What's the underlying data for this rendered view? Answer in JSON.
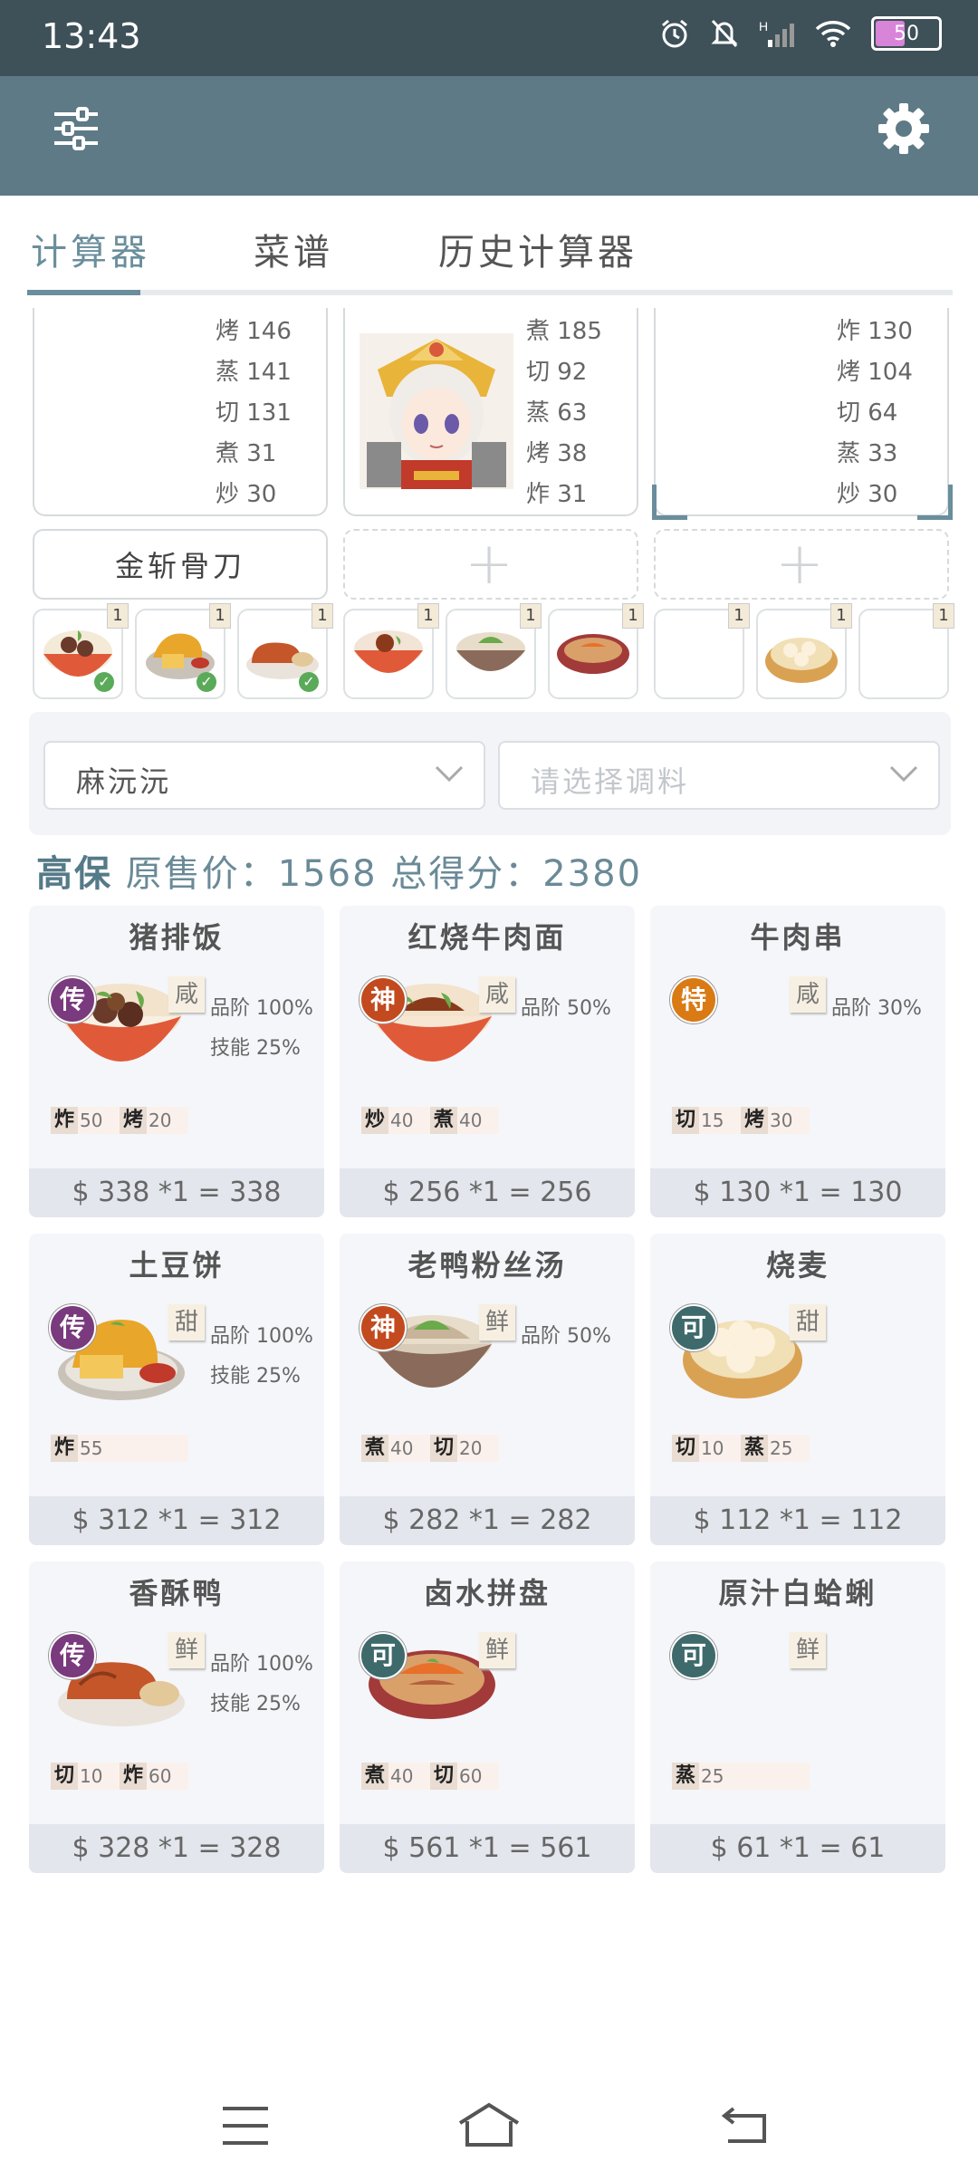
{
  "status": {
    "time": "13:43",
    "battery": "50"
  },
  "tabs": [
    {
      "label": "计算器"
    },
    {
      "label": "菜谱"
    },
    {
      "label": "历史计算器"
    }
  ],
  "chefs": [
    {
      "skills": [
        "烤 146",
        "蒸 141",
        "切 131",
        "煮 31",
        "炒 30"
      ],
      "equip": "金斩骨刀"
    },
    {
      "skills": [
        "煮 185",
        "切 92",
        "蒸 63",
        "烤 38",
        "炸 31"
      ],
      "equip": "+"
    },
    {
      "skills": [
        "炸 130",
        "烤 104",
        "切 64",
        "蒸 33",
        "炒 30"
      ],
      "equip": "+"
    }
  ],
  "slots": [
    {
      "qty": "1",
      "icon": "pork-rice"
    },
    {
      "qty": "1",
      "icon": "potato-cake"
    },
    {
      "qty": "1",
      "icon": "crispy-duck"
    },
    {
      "qty": "1",
      "icon": "beef-noodle"
    },
    {
      "qty": "1",
      "icon": "duck-soup"
    },
    {
      "qty": "1",
      "icon": "braised-platter"
    },
    {
      "qty": "1",
      "icon": "empty"
    },
    {
      "qty": "1",
      "icon": "shaomai"
    },
    {
      "qty": "1",
      "icon": "empty"
    }
  ],
  "condiment": {
    "chef_select": "麻沅沅",
    "seasoning_placeholder": "请选择调料"
  },
  "summary": {
    "chef": "高保",
    "text": "原售价：1568 总得分：2380"
  },
  "colors": {
    "accent": "#6a8e9c",
    "appbar": "#5e7a86",
    "rarity_chuan": "#7a3a7e",
    "rarity_shen": "#c24a1e",
    "rarity_te": "#d97a15",
    "rarity_ke": "#3f6a6c"
  },
  "dishes": [
    {
      "name": "猪排饭",
      "rarity": "传",
      "rcolor": "#7a3a7e",
      "flavor": "咸",
      "q1": "品阶 100%",
      "q2": "技能 25%",
      "reqs": [
        [
          "炸",
          "50"
        ],
        [
          "烤",
          "20"
        ]
      ],
      "price": "$ 338 *1 = 338",
      "icon": "pork-rice"
    },
    {
      "name": "红烧牛肉面",
      "rarity": "神",
      "rcolor": "#c24a1e",
      "flavor": "咸",
      "q1": "品阶 50%",
      "q2": "",
      "reqs": [
        [
          "炒",
          "40"
        ],
        [
          "煮",
          "40"
        ]
      ],
      "price": "$ 256 *1 = 256",
      "icon": "beef-noodle"
    },
    {
      "name": "牛肉串",
      "rarity": "特",
      "rcolor": "#d97a15",
      "flavor": "咸",
      "q1": "品阶 30%",
      "q2": "",
      "reqs": [
        [
          "切",
          "15"
        ],
        [
          "烤",
          "30"
        ]
      ],
      "price": "$ 130 *1 = 130",
      "icon": "none"
    },
    {
      "name": "土豆饼",
      "rarity": "传",
      "rcolor": "#7a3a7e",
      "flavor": "甜",
      "q1": "品阶 100%",
      "q2": "技能 25%",
      "reqs": [
        [
          "炸",
          "55"
        ]
      ],
      "price": "$ 312 *1 = 312",
      "icon": "potato-cake"
    },
    {
      "name": "老鸭粉丝汤",
      "rarity": "神",
      "rcolor": "#c24a1e",
      "flavor": "鲜",
      "q1": "品阶 50%",
      "q2": "",
      "reqs": [
        [
          "煮",
          "40"
        ],
        [
          "切",
          "20"
        ]
      ],
      "price": "$ 282 *1 = 282",
      "icon": "duck-soup"
    },
    {
      "name": "烧麦",
      "rarity": "可",
      "rcolor": "#3f6a6c",
      "flavor": "甜",
      "q1": "",
      "q2": "",
      "reqs": [
        [
          "切",
          "10"
        ],
        [
          "蒸",
          "25"
        ]
      ],
      "price": "$ 112 *1 = 112",
      "icon": "shaomai"
    },
    {
      "name": "香酥鸭",
      "rarity": "传",
      "rcolor": "#7a3a7e",
      "flavor": "鲜",
      "q1": "品阶 100%",
      "q2": "技能 25%",
      "reqs": [
        [
          "切",
          "10"
        ],
        [
          "炸",
          "60"
        ]
      ],
      "price": "$ 328 *1 = 328",
      "icon": "crispy-duck"
    },
    {
      "name": "卤水拼盘",
      "rarity": "可",
      "rcolor": "#3f6a6c",
      "flavor": "鲜",
      "q1": "",
      "q2": "",
      "reqs": [
        [
          "煮",
          "40"
        ],
        [
          "切",
          "60"
        ]
      ],
      "price": "$ 561 *1 = 561",
      "icon": "braised-platter"
    },
    {
      "name": "原汁白蛤蜊",
      "rarity": "可",
      "rcolor": "#3f6a6c",
      "flavor": "鲜",
      "q1": "",
      "q2": "",
      "reqs": [
        [
          "蒸",
          "25"
        ]
      ],
      "price": "$ 61 *1 = 61",
      "icon": "none"
    }
  ]
}
